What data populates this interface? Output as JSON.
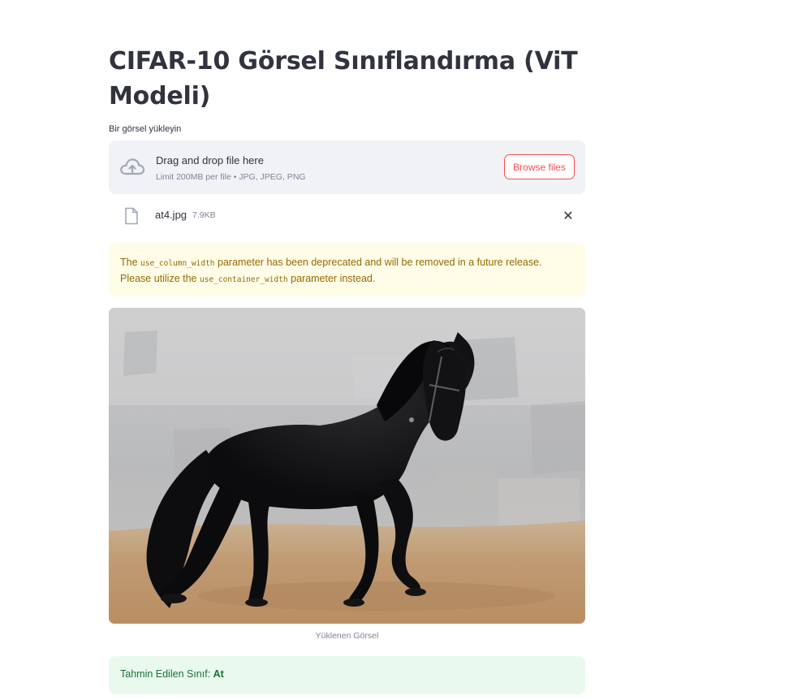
{
  "page": {
    "title": "CIFAR-10 Görsel Sınıflandırma (ViT Modeli)"
  },
  "uploader": {
    "label": "Bir görsel yükleyin",
    "dropzone_title": "Drag and drop file here",
    "dropzone_limit": "Limit 200MB per file • JPG, JPEG, PNG",
    "browse_label": "Browse files",
    "icon": "cloud-upload-icon"
  },
  "uploaded_file": {
    "name": "at4.jpg",
    "size": "7.9KB",
    "icon": "file-icon",
    "delete_glyph": "✕"
  },
  "warning": {
    "text_1": "The ",
    "code_1": "use_column_width",
    "text_2": " parameter has been deprecated and will be removed in a future release. Please utilize the ",
    "code_2": "use_container_width",
    "text_3": " parameter instead."
  },
  "image": {
    "caption": "Yüklenen Görsel"
  },
  "result": {
    "prefix": "Tahmin Edilen Sınıf: ",
    "value": "At"
  },
  "colors": {
    "accent": "#ff4b4b",
    "warning_bg": "#fffce7",
    "warning_text": "#926c05",
    "success_bg": "#e9f9ee",
    "success_text": "#177233",
    "dropzone_bg": "#f0f2f6"
  }
}
